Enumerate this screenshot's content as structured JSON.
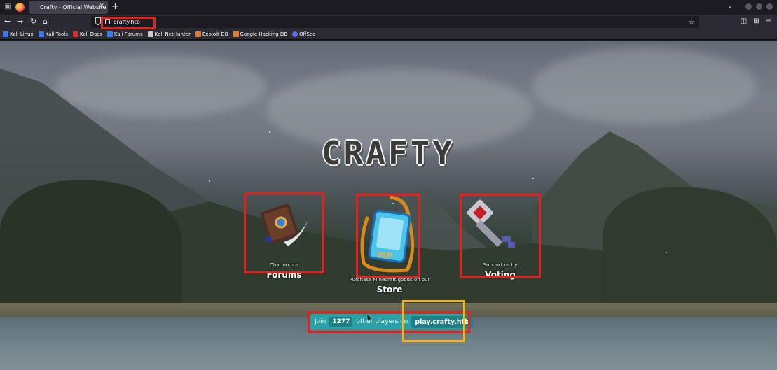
{
  "browser": {
    "tab_title": "Crafty - Official Website",
    "tab_close": "✕",
    "new_tab": "+",
    "url": "crafty.htb",
    "bookmarks": [
      {
        "label": "Kali Linux",
        "color": "#367bf0"
      },
      {
        "label": "Kali Tools",
        "color": "#367bf0"
      },
      {
        "label": "Kali Docs",
        "color": "#d92d2d"
      },
      {
        "label": "Kali Forums",
        "color": "#367bf0"
      },
      {
        "label": "Kali NetHunter",
        "color": "#cccccc"
      },
      {
        "label": "Exploit-DB",
        "color": "#e57a29"
      },
      {
        "label": "Google Hacking DB",
        "color": "#e57a29"
      },
      {
        "label": "OffSec",
        "color": "#5b6cf0"
      }
    ]
  },
  "page": {
    "logo": "CRAFTY",
    "cards": [
      {
        "subtitle": "Chat on our",
        "title": "Forums"
      },
      {
        "subtitle": "Purchase Minecraft goods on our",
        "title": "Store"
      },
      {
        "subtitle": "Support us by",
        "title": "Voting"
      }
    ],
    "join": {
      "prefix": "Join",
      "count": "1277",
      "middle": "other players on",
      "server": "play.crafty.htb"
    }
  },
  "annotation_colors": {
    "red": "#e5211d",
    "yellow": "#f0b41e"
  },
  "theme": {
    "accent": "#2aa1a6"
  }
}
